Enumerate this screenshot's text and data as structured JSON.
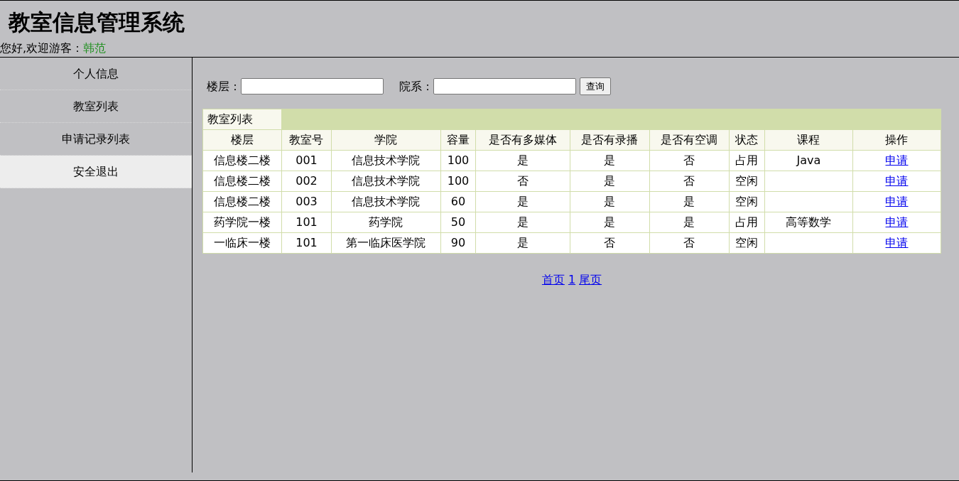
{
  "header": {
    "title": "教室信息管理系统",
    "greeting": "您好,欢迎游客：",
    "username": "韩范"
  },
  "sidebar": {
    "items": [
      {
        "label": "个人信息",
        "selected": false
      },
      {
        "label": "教室列表",
        "selected": false
      },
      {
        "label": "申请记录列表",
        "selected": false
      },
      {
        "label": "安全退出",
        "selected": true
      }
    ]
  },
  "search": {
    "fields": [
      {
        "label": "楼层："
      },
      {
        "label": "院系："
      }
    ],
    "button": "查询"
  },
  "table": {
    "caption": "教室列表",
    "columns": [
      "楼层",
      "教室号",
      "学院",
      "容量",
      "是否有多媒体",
      "是否有录播",
      "是否有空调",
      "状态",
      "课程",
      "操作"
    ],
    "rows": [
      [
        "信息楼二楼",
        "001",
        "信息技术学院",
        "100",
        "是",
        "是",
        "否",
        "占用",
        "Java",
        "申请"
      ],
      [
        "信息楼二楼",
        "002",
        "信息技术学院",
        "100",
        "否",
        "是",
        "否",
        "空闲",
        "",
        "申请"
      ],
      [
        "信息楼二楼",
        "003",
        "信息技术学院",
        "60",
        "是",
        "是",
        "是",
        "空闲",
        "",
        "申请"
      ],
      [
        "药学院一楼",
        "101",
        "药学院",
        "50",
        "是",
        "是",
        "是",
        "占用",
        "高等数学",
        "申请"
      ],
      [
        "一临床一楼",
        "101",
        "第一临床医学院",
        "90",
        "是",
        "否",
        "否",
        "空闲",
        "",
        "申请"
      ]
    ]
  },
  "pagination": [
    "首页",
    "1",
    "尾页"
  ]
}
